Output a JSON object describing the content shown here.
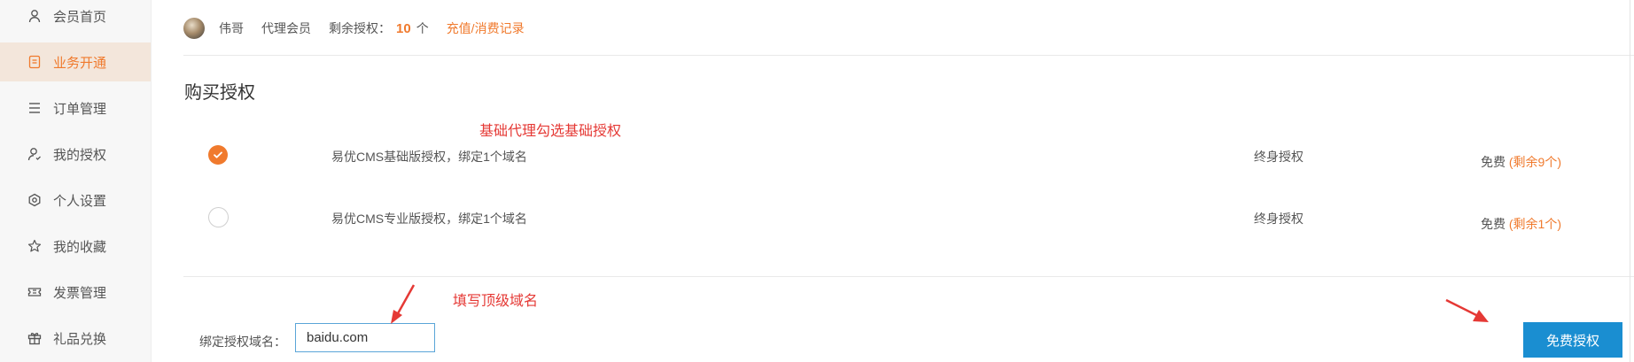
{
  "sidebar": {
    "items": [
      {
        "label": "会员首页",
        "icon": "user-icon"
      },
      {
        "label": "业务开通",
        "icon": "document-icon",
        "active": true
      },
      {
        "label": "订单管理",
        "icon": "list-icon"
      },
      {
        "label": "我的授权",
        "icon": "user-key-icon"
      },
      {
        "label": "个人设置",
        "icon": "settings-icon"
      },
      {
        "label": "我的收藏",
        "icon": "star-icon"
      },
      {
        "label": "发票管理",
        "icon": "ticket-icon"
      },
      {
        "label": "礼品兑换",
        "icon": "gift-icon"
      }
    ]
  },
  "user": {
    "name": "伟哥",
    "level": "代理会员",
    "remaining_label": "剩余授权：",
    "remaining_count": "10",
    "unit": "个",
    "recharge_link": "充值/消费记录"
  },
  "section": {
    "title": "购买授权"
  },
  "annotations": {
    "basic_hint": "基础代理勾选基础授权",
    "domain_hint": "填写顶级域名"
  },
  "licenses": [
    {
      "name": "易优CMS基础版授权，绑定1个域名",
      "term": "终身授权",
      "price": "免费",
      "remaining": "(剩余9个)",
      "checked": true
    },
    {
      "name": "易优CMS专业版授权，绑定1个域名",
      "term": "终身授权",
      "price": "免费",
      "remaining": "(剩余1个)",
      "checked": false
    }
  ],
  "domain_form": {
    "label": "绑定授权域名：",
    "value": "baidu.com",
    "submit_label": "免费授权"
  },
  "colors": {
    "accent": "#f07a2d",
    "primary_button": "#1a8ed1",
    "annotation": "#e53935",
    "sidebar_active_bg": "#f3e6db"
  }
}
